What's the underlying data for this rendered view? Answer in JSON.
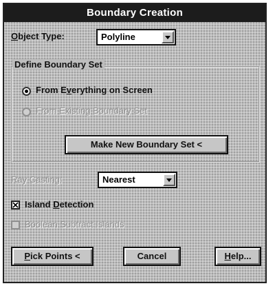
{
  "window": {
    "title": "Boundary Creation"
  },
  "object_type": {
    "label_first": "O",
    "label_rest": "bject Type:",
    "value": "Polyline"
  },
  "boundary_set": {
    "group_title": "Define Boundary Set",
    "option_everything": {
      "pre": "From E",
      "accel": "v",
      "post": "erything on Screen",
      "checked": true
    },
    "option_existing": {
      "text": "From Existing Boundary Set",
      "checked": false,
      "enabled": false
    },
    "make_new_button": "Make New Boundary Set <"
  },
  "ray_casting": {
    "label": "Ray Casting:",
    "value": "Nearest",
    "enabled": false
  },
  "island_detection": {
    "pre": "Island ",
    "accel": "D",
    "post": "etection",
    "checked": true
  },
  "boolean_subtract": {
    "text": "Boolean Subtract Islands",
    "checked": false,
    "enabled": false
  },
  "buttons": {
    "pick_points_accel": "P",
    "pick_points_rest": "ick Points <",
    "cancel": "Cancel",
    "help_accel": "H",
    "help_rest": "elp..."
  }
}
